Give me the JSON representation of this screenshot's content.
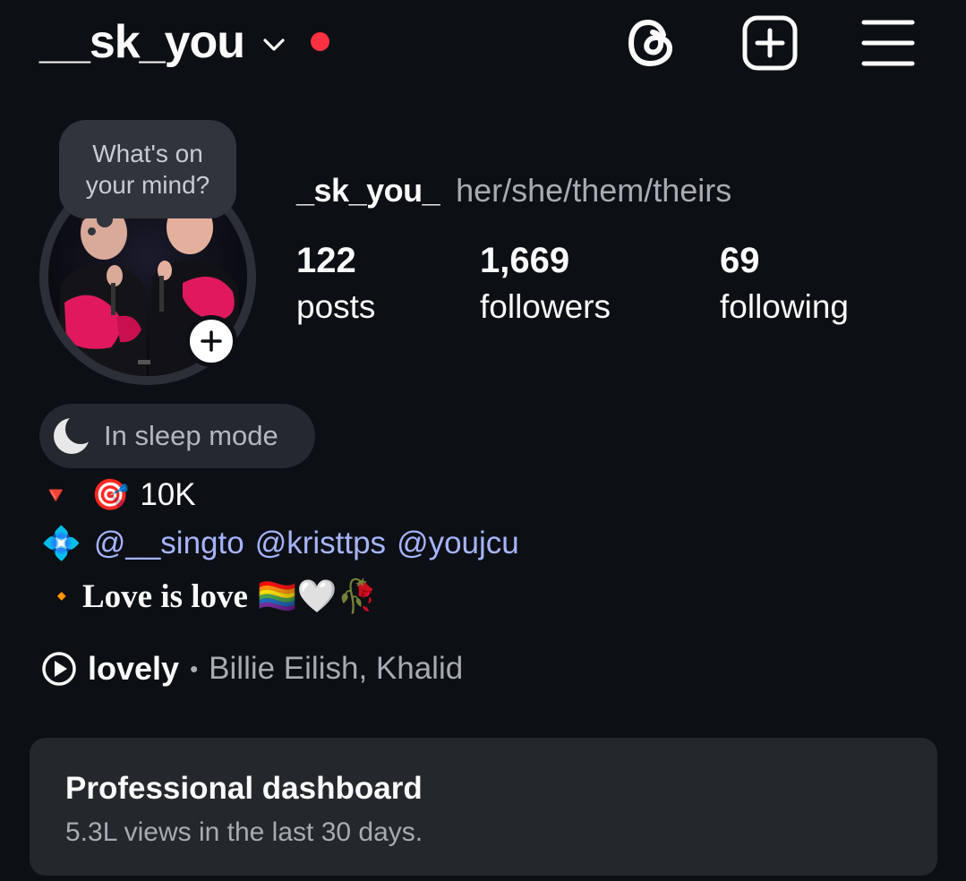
{
  "header": {
    "username": "__sk_you",
    "colors": {
      "notification_dot": "#ff3040"
    },
    "icons": [
      "chevron-down-icon",
      "threads-icon",
      "create-plus-icon",
      "hamburger-menu-icon"
    ]
  },
  "profile": {
    "note_text": "What's on your mind?",
    "display_name": "_sk_you_",
    "pronouns": "her/she/them/theirs",
    "stats": {
      "posts": {
        "count": "122",
        "label": "posts"
      },
      "followers": {
        "count": "1,669",
        "label": "followers"
      },
      "following": {
        "count": "69",
        "label": "following"
      }
    }
  },
  "status": {
    "label": "In sleep mode",
    "icon": "moon-icon"
  },
  "bio": {
    "line1": {
      "emoji_1": "🔻",
      "emoji_2": "🎯",
      "text": "10K"
    },
    "line2": {
      "emoji": "💠",
      "mentions": [
        "@__singto",
        "@kristtps",
        "@youjcu"
      ]
    },
    "line3": {
      "emoji_1": "🔸",
      "text": "Love is love",
      "emoji_2": "🏳️‍🌈",
      "emoji_3": "🤍",
      "emoji_4": "🥀"
    }
  },
  "music": {
    "song": "lovely",
    "separator": "•",
    "artist": "Billie Eilish, Khalid",
    "icon": "play-circle-icon"
  },
  "dashboard": {
    "title": "Professional dashboard",
    "subtitle": "5.3L views in the last 30 days."
  }
}
